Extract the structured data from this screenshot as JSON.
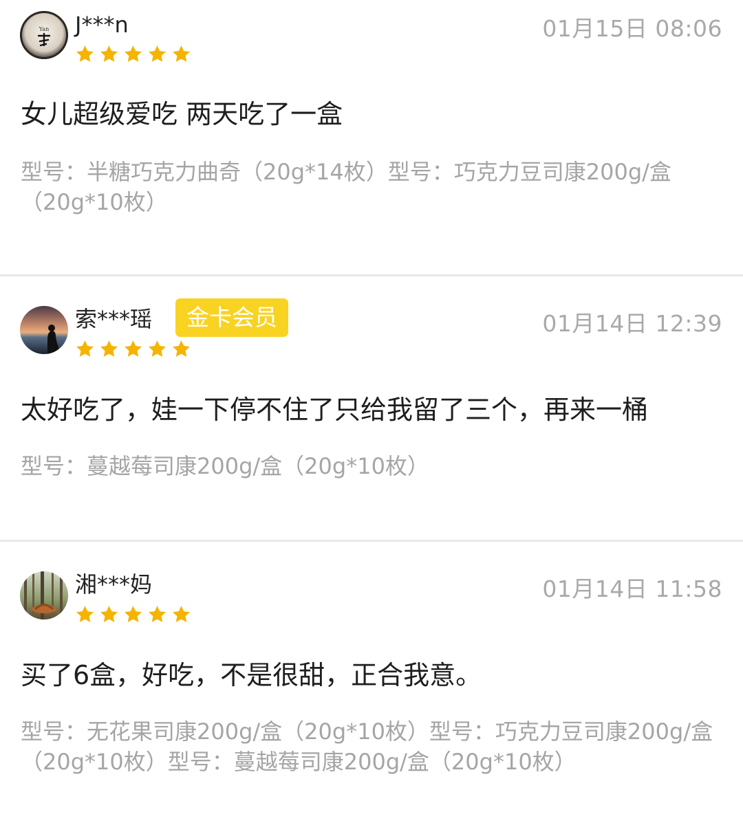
{
  "reviews": [
    {
      "username": "J***n",
      "date": "01月15日 08:06",
      "rating": 5,
      "avatar_icon": "calligraphy-avatar-icon",
      "content": "女儿超级爱吃 两天吃了一盒",
      "spec": "型号：半糖巧克力曲奇（20g*14枚）型号：巧克力豆司康200g/盒（20g*10枚）"
    },
    {
      "username": "索***瑶",
      "badge": "金卡会员",
      "date": "01月14日 12:39",
      "rating": 5,
      "avatar_icon": "sunset-silhouette-avatar-icon",
      "content": "太好吃了，娃一下停不住了只给我留了三个，再来一桶",
      "spec": "型号：蔓越莓司康200g/盒（20g*10枚）"
    },
    {
      "username": "湘***妈",
      "date": "01月14日 11:58",
      "rating": 5,
      "avatar_icon": "forest-avatar-icon",
      "content": "买了6盒，好吃，不是很甜，正合我意。",
      "spec": "型号：无花果司康200g/盒（20g*10枚）型号：巧克力豆司康200g/盒（20g*10枚）型号：蔓越莓司康200g/盒（20g*10枚）"
    }
  ],
  "colors": {
    "star": "#f5b400",
    "badge_bg": "#f9d321",
    "date_text": "#a9a9a9",
    "spec_text": "#a5a5a5",
    "divider": "#e8e8e8"
  }
}
